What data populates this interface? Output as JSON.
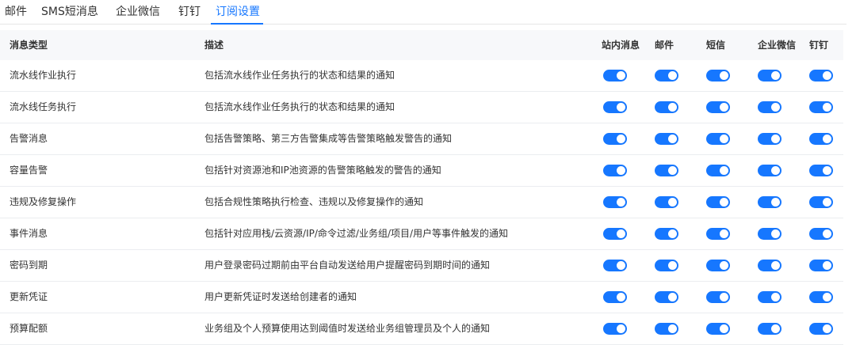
{
  "tabs": [
    {
      "label": "邮件",
      "active": false
    },
    {
      "label": "SMS短消息",
      "active": false
    },
    {
      "label": "企业微信",
      "active": false
    },
    {
      "label": "钉钉",
      "active": false
    },
    {
      "label": "订阅设置",
      "active": true
    }
  ],
  "table": {
    "headers": {
      "type": "消息类型",
      "description": "描述",
      "channels": [
        "站内消息",
        "邮件",
        "短信",
        "企业微信",
        "钉钉"
      ]
    },
    "rows": [
      {
        "type": "流水线作业执行",
        "description": "包括流水线作业任务执行的状态和结果的通知",
        "toggles": [
          true,
          true,
          true,
          true,
          true
        ]
      },
      {
        "type": "流水线任务执行",
        "description": "包括流水线作业任务执行的状态和结果的通知",
        "toggles": [
          true,
          true,
          true,
          true,
          true
        ]
      },
      {
        "type": "告警消息",
        "description": "包括告警策略、第三方告警集成等告警策略触发警告的通知",
        "toggles": [
          true,
          true,
          true,
          true,
          true
        ]
      },
      {
        "type": "容量告警",
        "description": "包括针对资源池和IP池资源的告警策略触发的警告的通知",
        "toggles": [
          true,
          true,
          true,
          true,
          true
        ]
      },
      {
        "type": "违规及修复操作",
        "description": "包括合规性策略执行检查、违规以及修复操作的通知",
        "toggles": [
          true,
          true,
          true,
          true,
          true
        ]
      },
      {
        "type": "事件消息",
        "description": "包括针对应用栈/云资源/IP/命令过滤/业务组/项目/用户等事件触发的通知",
        "toggles": [
          true,
          true,
          true,
          true,
          true
        ]
      },
      {
        "type": "密码到期",
        "description": "用户登录密码过期前由平台自动发送给用户提醒密码到期时间的通知",
        "toggles": [
          true,
          true,
          true,
          true,
          true
        ]
      },
      {
        "type": "更新凭证",
        "description": "用户更新凭证时发送给创建者的通知",
        "toggles": [
          true,
          true,
          true,
          true,
          true
        ]
      },
      {
        "type": "预算配额",
        "description": "业务组及个人预算使用达到阈值时发送给业务组管理员及个人的通知",
        "toggles": [
          true,
          true,
          true,
          true,
          true
        ]
      }
    ]
  },
  "colors": {
    "accent": "#1677ff",
    "toggle_off": "#c9cdd4",
    "header_bg": "#f7f8fa"
  }
}
